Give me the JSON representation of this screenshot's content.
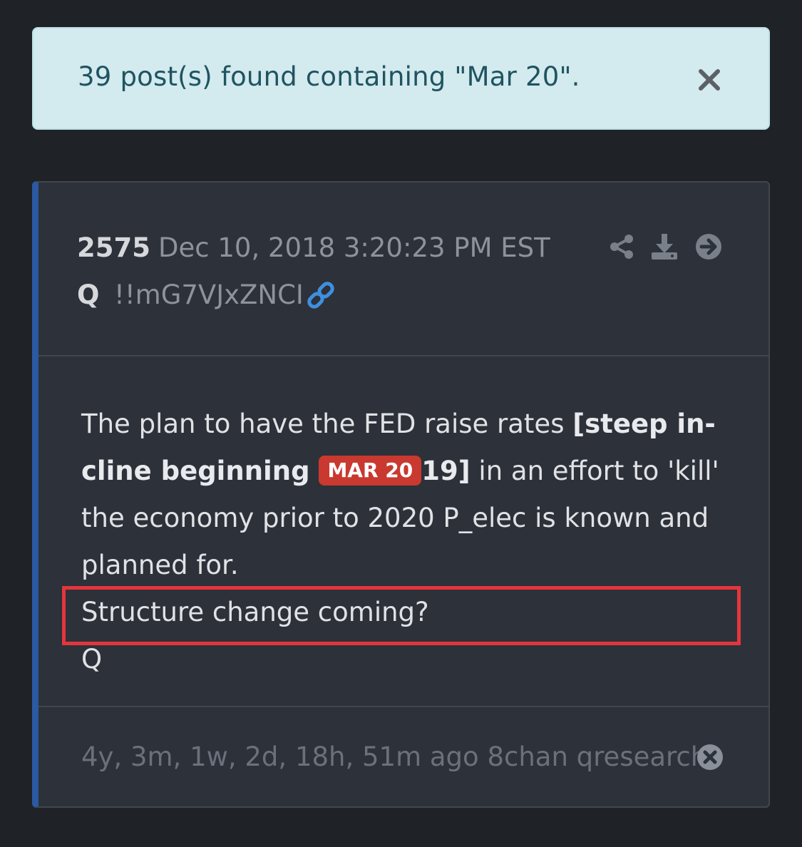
{
  "alert": {
    "message": "39 post(s) found containing \"Mar 20\".",
    "close_icon": "close-x-icon"
  },
  "post": {
    "number": "2575",
    "timestamp": "Dec 10, 2018 3:20:23 PM EST",
    "author": "Q",
    "tripcode": "!!mG7VJxZNCI",
    "header_icons": [
      "share-icon",
      "download-icon",
      "arrow-right-circle-icon"
    ],
    "link_icon": "link-icon",
    "body": {
      "part1": "The plan to have the FED raise rates ",
      "bold1": "[steep in-cline beginning ",
      "tag": "MAR 20",
      "bold2": "19]",
      "part2": " in an effort to 'kill' the economy prior to 2020 P_elec is known and planned for.",
      "line2": "Structure change coming?",
      "signature": "Q"
    },
    "footer": {
      "relative_time": "4y, 3m, 1w, 2d, 18h, 51m ago",
      "source": "8chan qresearch",
      "close_icon": "close-circle-icon"
    }
  },
  "colors": {
    "background": "#1f2226",
    "card": "#2d3139",
    "accent_border": "#2b5aa3",
    "alert_bg": "#d3eaee",
    "tag_red": "#c9392f",
    "highlight_red": "#e5353c",
    "link_blue": "#3f8fe0"
  }
}
